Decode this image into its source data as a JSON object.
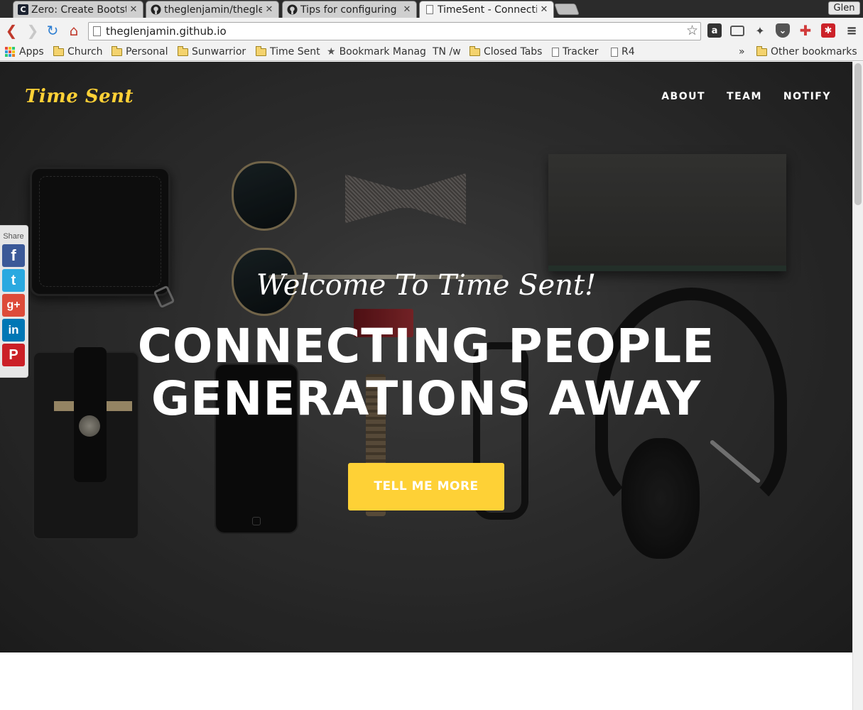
{
  "browser": {
    "tabs": [
      {
        "title": "Zero: Create Bootstr",
        "icon": "c-logo-icon"
      },
      {
        "title": "theglenjamin/thegle",
        "icon": "github-icon"
      },
      {
        "title": "Tips for configuring",
        "icon": "github-icon"
      },
      {
        "title": "TimeSent - Connecti",
        "icon": "page-icon"
      }
    ],
    "close_glyph": "✕",
    "profile": "Glen",
    "url": "theglenjamin.github.io",
    "bookmarks": [
      {
        "label": "Apps",
        "icon": "apps-icon"
      },
      {
        "label": "Church",
        "icon": "folder-icon"
      },
      {
        "label": "Personal",
        "icon": "folder-icon"
      },
      {
        "label": "Sunwarrior",
        "icon": "folder-icon"
      },
      {
        "label": "Time Sent",
        "icon": "folder-icon"
      },
      {
        "label": "Bookmark Manag",
        "icon": "star-icon"
      },
      {
        "label": "TN /w",
        "icon": "tn-icon"
      },
      {
        "label": "Closed Tabs",
        "icon": "folder-icon"
      },
      {
        "label": "Tracker",
        "icon": "page-icon"
      },
      {
        "label": "R4",
        "icon": "page-icon"
      }
    ],
    "overflow": "»",
    "other_bookmarks": "Other bookmarks"
  },
  "site": {
    "brand": "Time Sent",
    "nav": [
      "ABOUT",
      "TEAM",
      "NOTIFY"
    ],
    "lead_in": "Welcome To Time Sent!",
    "heading_line1": "CONNECTING PEOPLE",
    "heading_line2": "GENERATIONS AWAY",
    "cta": "TELL ME MORE"
  },
  "share": {
    "label": "Share",
    "buttons": [
      {
        "name": "facebook",
        "glyph": "f",
        "color": "#3b5998"
      },
      {
        "name": "twitter",
        "glyph": "t",
        "color": "#2aa9e0"
      },
      {
        "name": "google-plus",
        "glyph": "g+",
        "color": "#dd4b39"
      },
      {
        "name": "linkedin",
        "glyph": "in",
        "color": "#0077b5"
      },
      {
        "name": "pinterest",
        "glyph": "P",
        "color": "#cb2027"
      }
    ]
  },
  "colors": {
    "accent": "#fed136",
    "hero_text": "#ffffff",
    "tab_strip": "#2b2b2b"
  }
}
